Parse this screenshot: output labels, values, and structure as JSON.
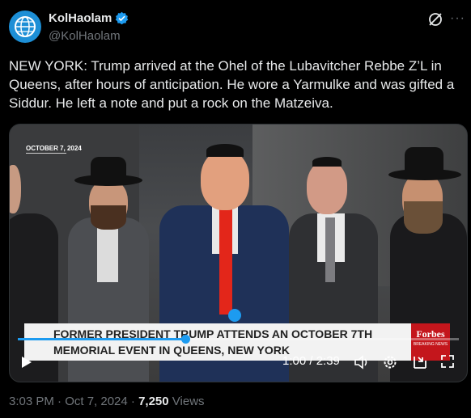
{
  "header": {
    "display_name": "KolHaolam",
    "handle": "@KolHaolam",
    "verified_color": "#1d9bf0"
  },
  "tweet": {
    "text": "NEW YORK: Trump arrived at the Ohel of the Lubavitcher Rebbe Z’L in Queens, after hours of anticipation. He wore a Yarmulke and was gifted a Siddur. He left a note and put a rock on the Matzeiva."
  },
  "video": {
    "date_tag": "OCTOBER 7, 2024",
    "headline_line1": "FORMER PRESIDENT TRUMP ATTENDS AN OCTOBER 7TH",
    "headline_line2": "MEMORIAL EVENT IN QUEENS, NEW YORK",
    "brand": "Forbes",
    "brand_sub": "BREAKING NEWS",
    "time": "1:00 / 2:39",
    "progress": 0.38,
    "icons": [
      "play-icon",
      "volume-icon",
      "gear-icon",
      "pip-icon",
      "expand-icon"
    ]
  },
  "footer": {
    "time": "3:03 PM · Oct 7, 2024 · ",
    "views_count": "7,250",
    "views_label": " Views"
  },
  "colors": {
    "accent": "#1d9bf0",
    "forbes_red": "#c4161c"
  }
}
